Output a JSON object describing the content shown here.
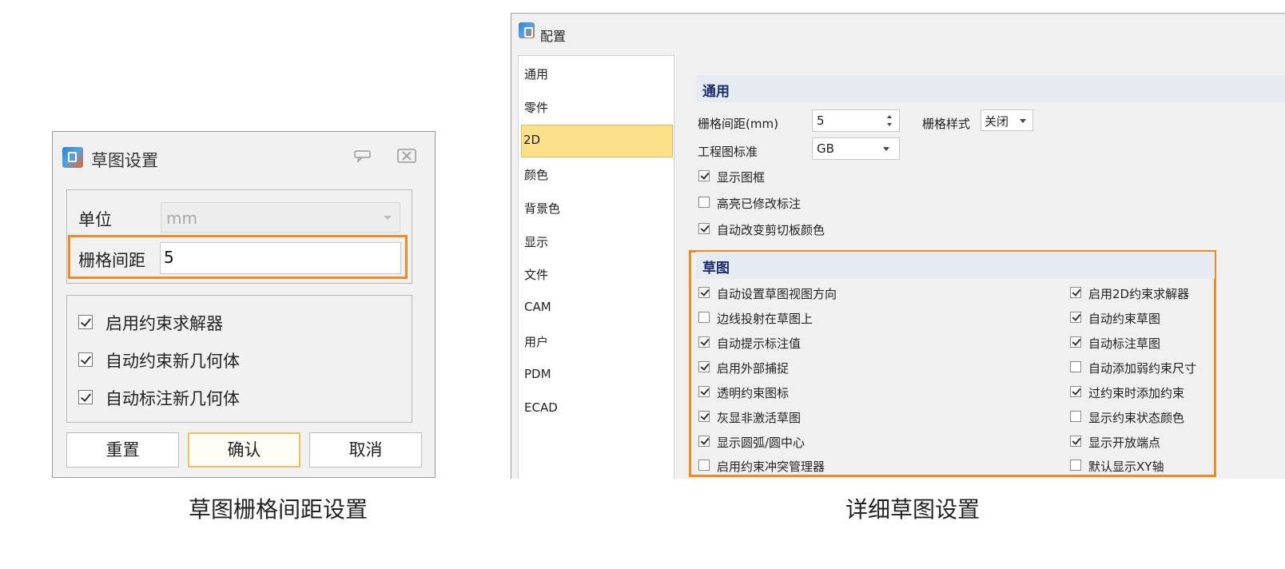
{
  "sketch_dialog": {
    "title": "草图设置",
    "unit_label": "单位",
    "unit_value": "mm",
    "grid_label": "栅格间距",
    "grid_value": "5",
    "checkboxes": [
      {
        "label": "启用约束求解器",
        "checked": true
      },
      {
        "label": "自动约束新几何体",
        "checked": true
      },
      {
        "label": "自动标注新几何体",
        "checked": true
      }
    ],
    "buttons": {
      "reset": "重置",
      "ok": "确认",
      "cancel": "取消"
    }
  },
  "config_window": {
    "title": "配置",
    "nav": [
      "通用",
      "零件",
      "2D",
      "颜色",
      "背景色",
      "显示",
      "文件",
      "CAM",
      "用户",
      "PDM",
      "ECAD"
    ],
    "selected_nav": "2D",
    "general": {
      "header": "通用",
      "grid_spacing_label": "栅格间距(mm)",
      "grid_spacing_value": "5",
      "grid_style_label": "栅格样式",
      "grid_style_value": "关闭",
      "drawing_standard_label": "工程图标准",
      "drawing_standard_value": "GB",
      "options": [
        {
          "label": "显示图框",
          "checked": true
        },
        {
          "label": "高亮已修改标注",
          "checked": false
        },
        {
          "label": "自动改变剪切板颜色",
          "checked": true
        }
      ]
    },
    "sketch": {
      "header": "草图",
      "left_options": [
        {
          "label": "自动设置草图视图方向",
          "checked": true
        },
        {
          "label": "边线投射在草图上",
          "checked": false
        },
        {
          "label": "自动提示标注值",
          "checked": true
        },
        {
          "label": "启用外部捕捉",
          "checked": true
        },
        {
          "label": "透明约束图标",
          "checked": true
        },
        {
          "label": "灰显非激活草图",
          "checked": true
        },
        {
          "label": "显示圆弧/圆中心",
          "checked": true
        },
        {
          "label": "启用约束冲突管理器",
          "checked": false
        }
      ],
      "right_options": [
        {
          "label": "启用2D约束求解器",
          "checked": true
        },
        {
          "label": "自动约束草图",
          "checked": true
        },
        {
          "label": "自动标注草图",
          "checked": true
        },
        {
          "label": "自动添加弱约束尺寸",
          "checked": false
        },
        {
          "label": "过约束时添加约束",
          "checked": true
        },
        {
          "label": "显示约束状态颜色",
          "checked": false
        },
        {
          "label": "显示开放端点",
          "checked": true
        },
        {
          "label": "默认显示XY轴",
          "checked": false
        }
      ]
    }
  },
  "captions": {
    "left": "草图栅格间距设置",
    "right": "详细草图设置"
  },
  "colors": {
    "highlight": "#f08a24",
    "selected_nav": "#fde08a",
    "section_header": "#1a2c6b"
  }
}
